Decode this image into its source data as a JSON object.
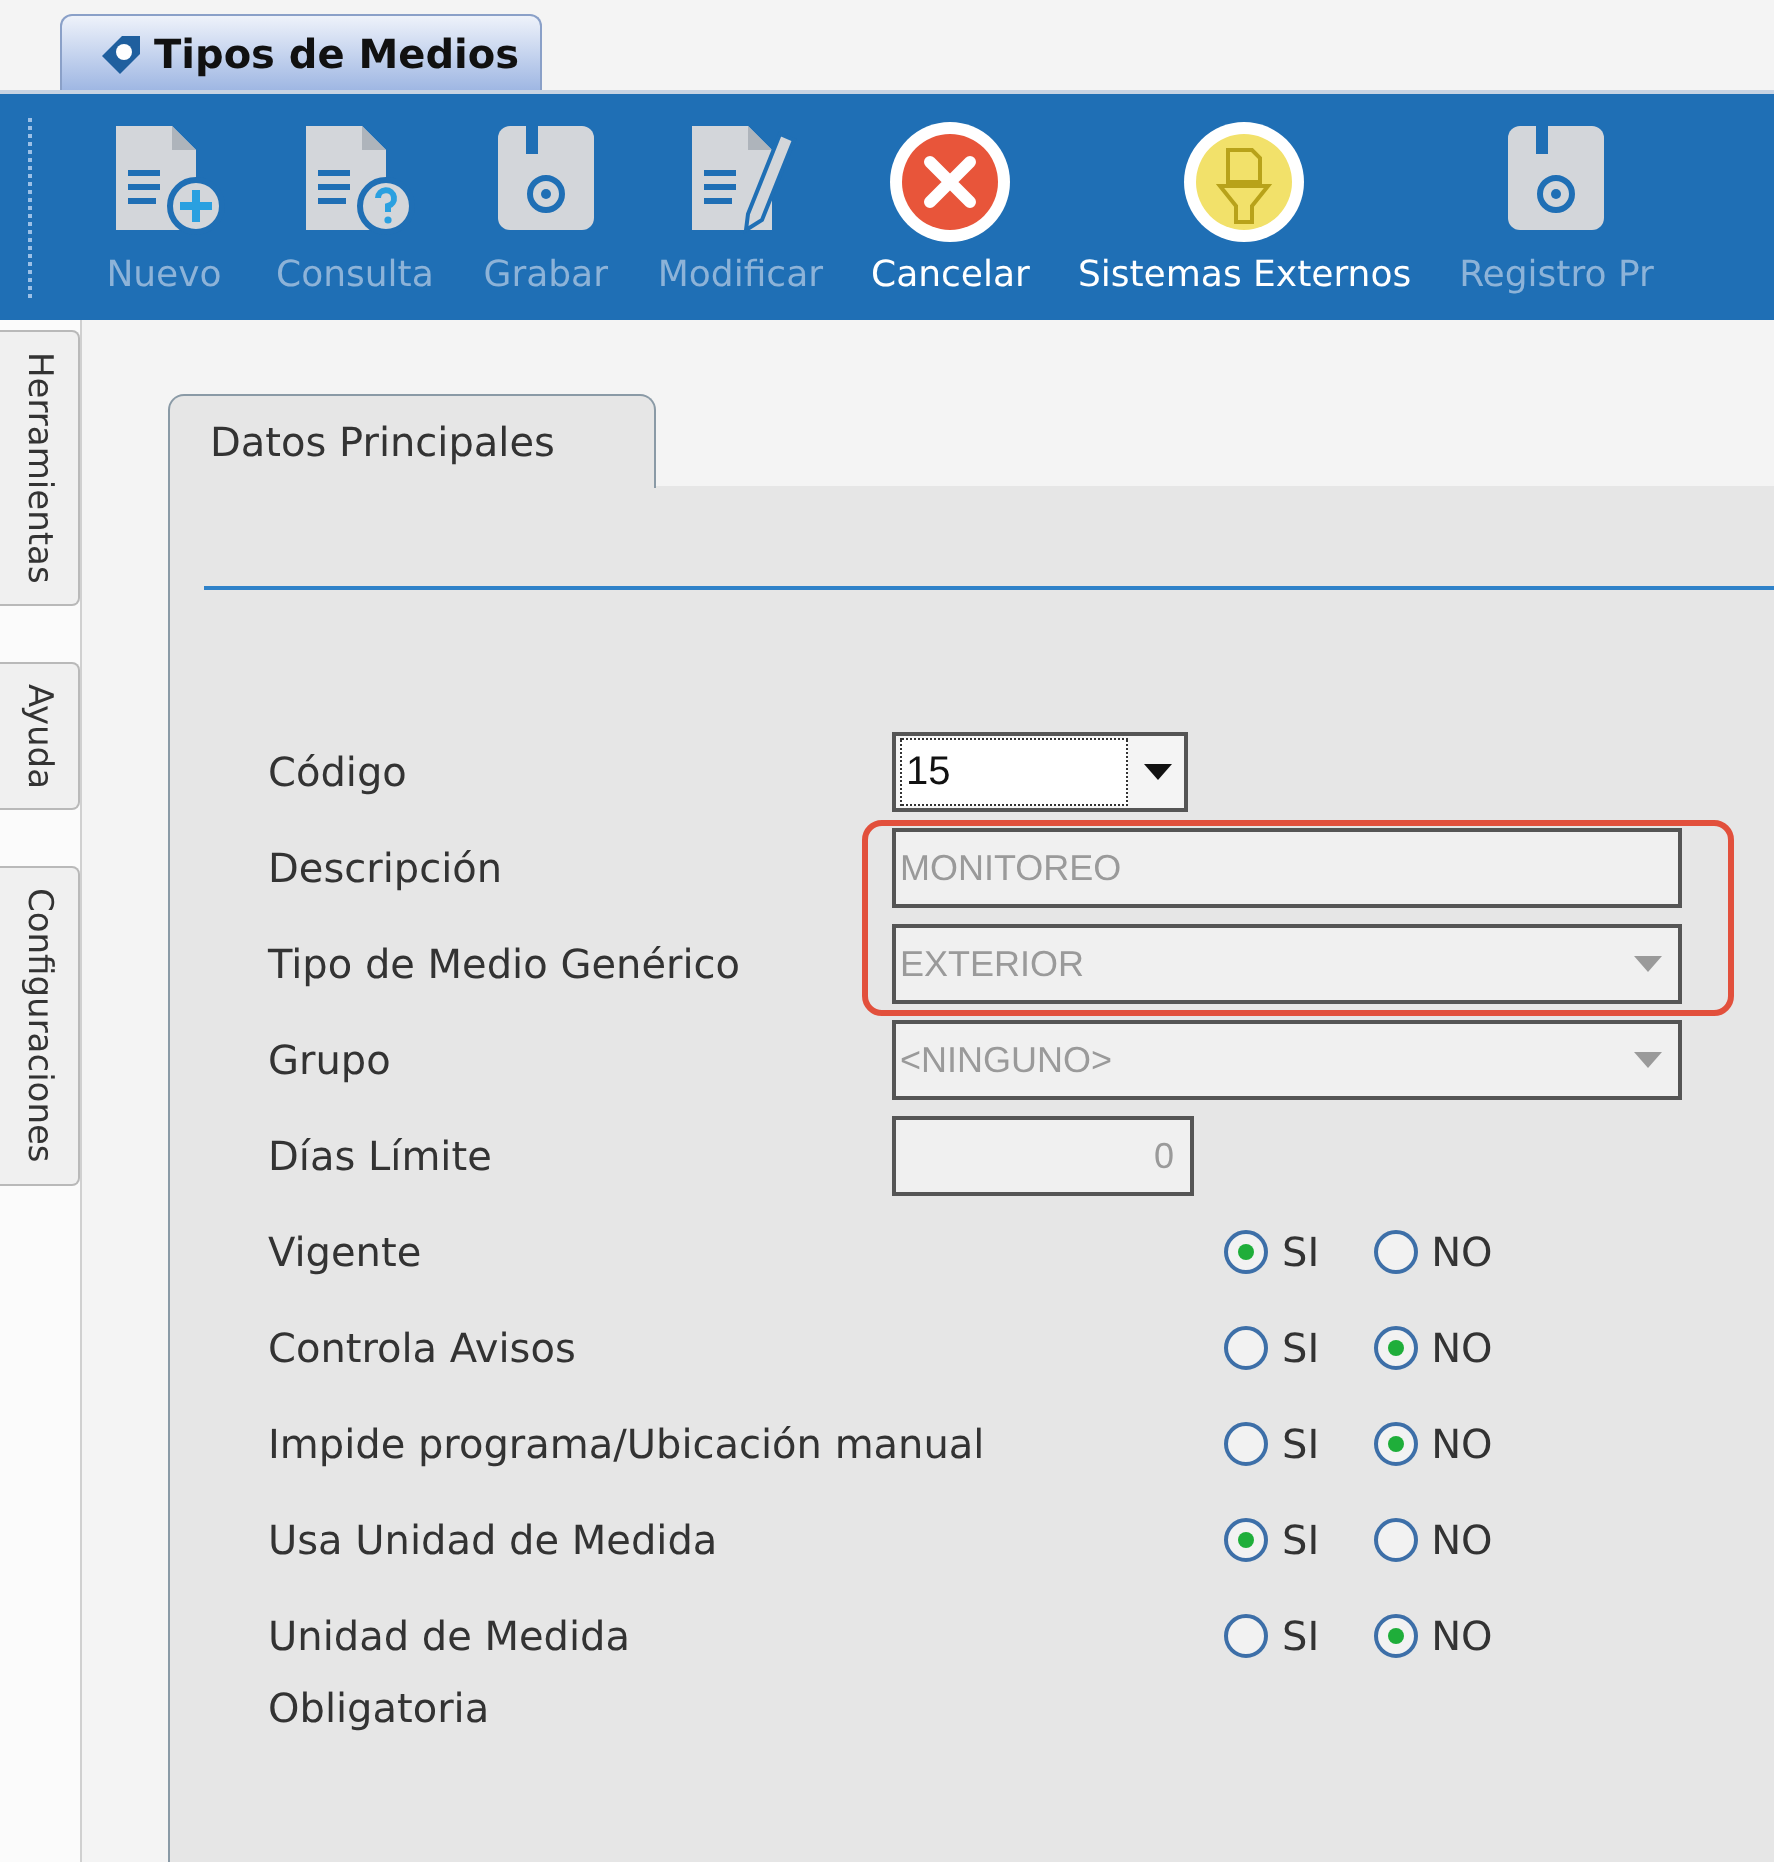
{
  "window": {
    "title": "Tipos de Medios"
  },
  "toolbar": [
    {
      "kind": "new",
      "label": "Nuevo",
      "disabled": true
    },
    {
      "kind": "query",
      "label": "Consulta",
      "disabled": true
    },
    {
      "kind": "save",
      "label": "Grabar",
      "disabled": true
    },
    {
      "kind": "edit",
      "label": "Modificar",
      "disabled": true
    },
    {
      "kind": "cancel",
      "label": "Cancelar",
      "disabled": false
    },
    {
      "kind": "external",
      "label": "Sistemas Externos",
      "disabled": false
    },
    {
      "kind": "save",
      "label": "Registro Pr",
      "disabled": true
    }
  ],
  "sidebar": {
    "tabs": [
      {
        "label": "Herramientas"
      },
      {
        "label": "Ayuda"
      },
      {
        "label": "Configuraciones"
      }
    ]
  },
  "panel": {
    "tabs": [
      {
        "label": "Datos Principales",
        "selected": true
      }
    ],
    "fields": [
      {
        "kind": "combo",
        "label": "Código",
        "value": "15",
        "focused": true,
        "disabled": false,
        "highlighted": false
      },
      {
        "kind": "text",
        "label": "Descripción",
        "value": "MONITOREO",
        "disabled": true,
        "highlighted": true
      },
      {
        "kind": "select",
        "label": "Tipo de Medio Genérico",
        "value": "EXTERIOR",
        "disabled": true,
        "highlighted": true
      },
      {
        "kind": "select",
        "label": "Grupo",
        "value": "<NINGUNO>",
        "disabled": true,
        "highlighted": false
      },
      {
        "kind": "number",
        "label": "Días Límite",
        "value": "0",
        "disabled": true,
        "highlighted": false
      },
      {
        "kind": "radio",
        "label": "Vigente",
        "options": [
          {
            "label": "SI",
            "selected": true
          },
          {
            "label": "NO",
            "selected": false
          }
        ]
      },
      {
        "kind": "radio",
        "label": "Controla Avisos",
        "options": [
          {
            "label": "SI",
            "selected": false
          },
          {
            "label": "NO",
            "selected": true
          }
        ]
      },
      {
        "kind": "radio",
        "label": "Impide programa/Ubicación manual",
        "options": [
          {
            "label": "SI",
            "selected": false
          },
          {
            "label": "NO",
            "selected": true
          }
        ]
      },
      {
        "kind": "radio",
        "label": "Usa Unidad de Medida",
        "options": [
          {
            "label": "SI",
            "selected": true
          },
          {
            "label": "NO",
            "selected": false
          }
        ]
      },
      {
        "kind": "radio",
        "label": "Unidad de Medida\nObligatoria",
        "options": [
          {
            "label": "SI",
            "selected": false
          },
          {
            "label": "NO",
            "selected": true
          }
        ]
      }
    ]
  }
}
